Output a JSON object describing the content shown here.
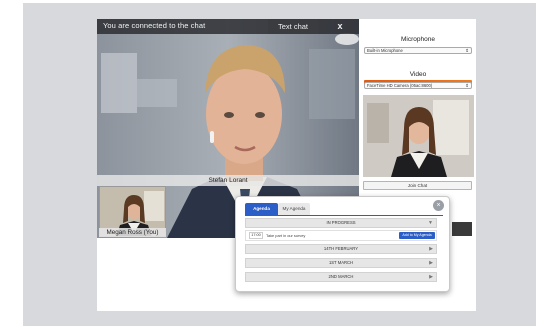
{
  "chat": {
    "status_text": "You are connected to the chat",
    "text_chat_label": "Text chat",
    "close_label": "x",
    "main_participant": "Stefan Lorant",
    "self_participant": "Megan Ross (You)"
  },
  "settings": {
    "microphone_heading": "Microphone",
    "microphone_device": "Built-in Microphone",
    "video_heading": "Video",
    "video_device": "FaceTime HD Camera (05ac:8600)",
    "join_label": "Join Chat",
    "mic_level": 1.0,
    "level_color": "#e8590c"
  },
  "agenda": {
    "tabs": [
      "Agenda",
      "My Agenda"
    ],
    "close_icon": "circle-x-icon",
    "sections": [
      {
        "label": "IN PROGRESS",
        "expanded": true
      },
      {
        "label": "14TH FEBRUARY",
        "expanded": false
      },
      {
        "label": "1ST MARCH",
        "expanded": false
      },
      {
        "label": "2ND MARCH",
        "expanded": false
      }
    ],
    "item": {
      "time": "17:00",
      "title": "Take part in our survey",
      "add_label": "Add to My Agenda"
    },
    "accent_color": "#2b5ec6"
  }
}
